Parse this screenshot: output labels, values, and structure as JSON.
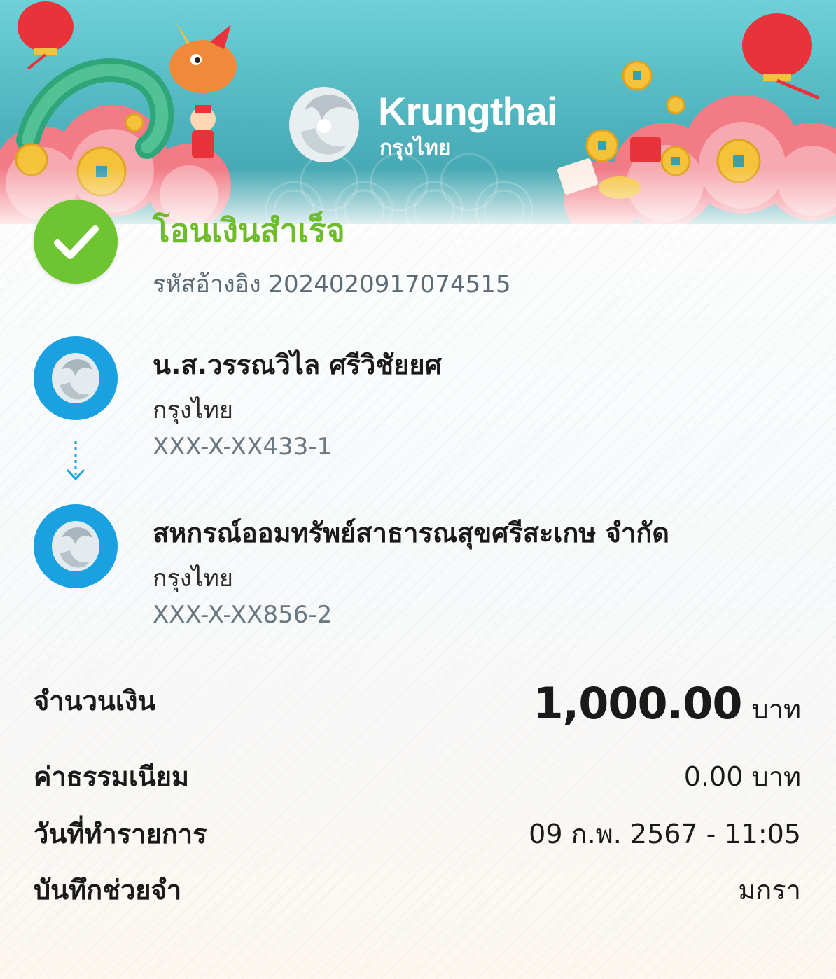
{
  "brand": {
    "name_en": "Krungthai",
    "name_th": "กรุงไทย"
  },
  "status": {
    "title": "โอนเงินสำเร็จ",
    "reference": "รหัสอ้างอิง 2024020917074515"
  },
  "sender": {
    "name": "น.ส.วรรณวิไล ศรีวิชัยยศ",
    "bank": "กรุงไทย",
    "account": "XXX-X-XX433-1"
  },
  "receiver": {
    "name": "สหกรณ์ออมทรัพย์สาธารณสุขศรีสะเกษ จำกัด",
    "bank": "กรุงไทย",
    "account": "XXX-X-XX856-2"
  },
  "details": {
    "amount_label": "จำนวนเงิน",
    "amount_value": "1,000.00",
    "amount_unit": "บาท",
    "fee_label": "ค่าธรรมเนียม",
    "fee_value": "0.00 บาท",
    "date_label": "วันที่ทำรายการ",
    "date_value": "09 ก.พ. 2567 - 11:05",
    "memo_label": "บันทึกช่วยจำ",
    "memo_value": "มกรา"
  },
  "colors": {
    "success": "#6ec531",
    "bank_blue": "#1aa1e2",
    "banner": "#4fb3bd"
  },
  "icons": [
    "check-icon",
    "krungthai-logo-icon",
    "down-arrow-icon"
  ]
}
